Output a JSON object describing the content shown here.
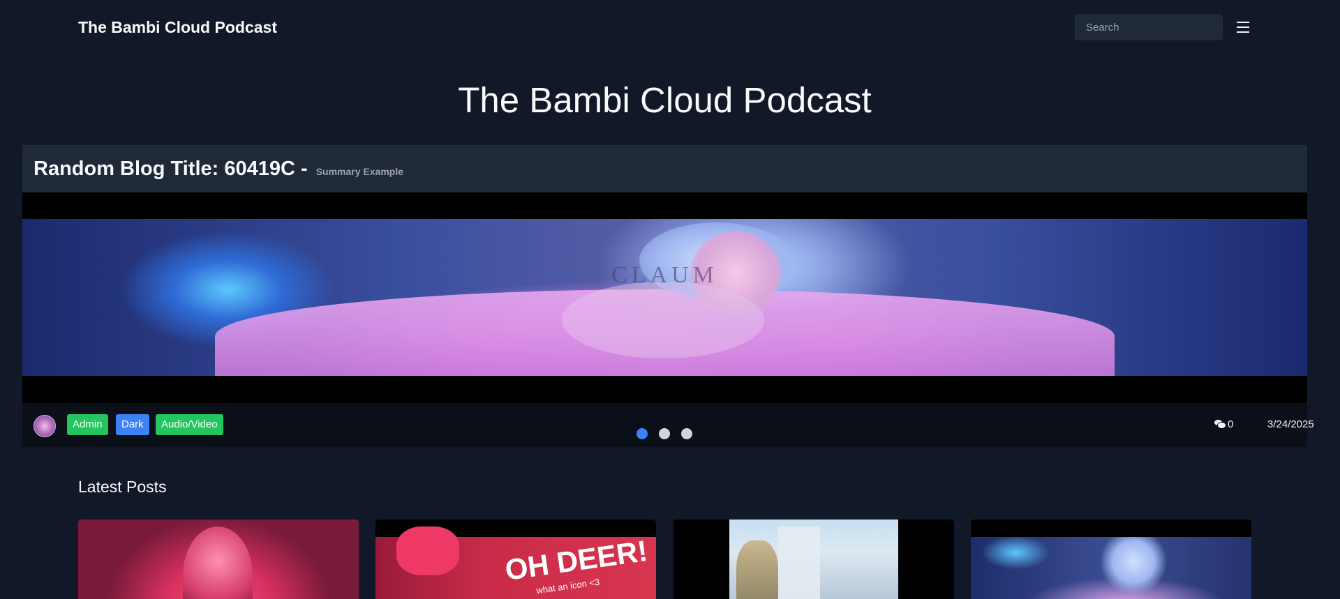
{
  "navbar": {
    "brand": "The Bambi Cloud Podcast",
    "search_placeholder": "Search",
    "menu_icon": "hamburger-menu-icon"
  },
  "page": {
    "title": "The Bambi Cloud Podcast"
  },
  "featured": {
    "title": "Random Blog Title: 60419C -",
    "summary": "Summary Example",
    "image_watermark": "CLAUM",
    "tags": [
      "Admin",
      "Dark",
      "Audio/Video"
    ],
    "tag_colors": [
      "#22c55e",
      "#3b82f6",
      "#22c55e"
    ],
    "comment_count": "0",
    "comment_icon": "comments-icon",
    "date": "3/24/2025",
    "carousel": {
      "slides": 3,
      "active_index": 0
    }
  },
  "latest": {
    "title": "Latest Posts",
    "cards": [
      {
        "alt": "post-1"
      },
      {
        "alt": "post-2",
        "image_text": "OH DEER!",
        "image_subtext": "what an icon <3"
      },
      {
        "alt": "post-3"
      },
      {
        "alt": "post-4"
      }
    ]
  },
  "colors": {
    "background": "#111827",
    "card_header": "#1f2937",
    "accent_blue": "#3b82f6",
    "accent_green": "#22c55e"
  }
}
